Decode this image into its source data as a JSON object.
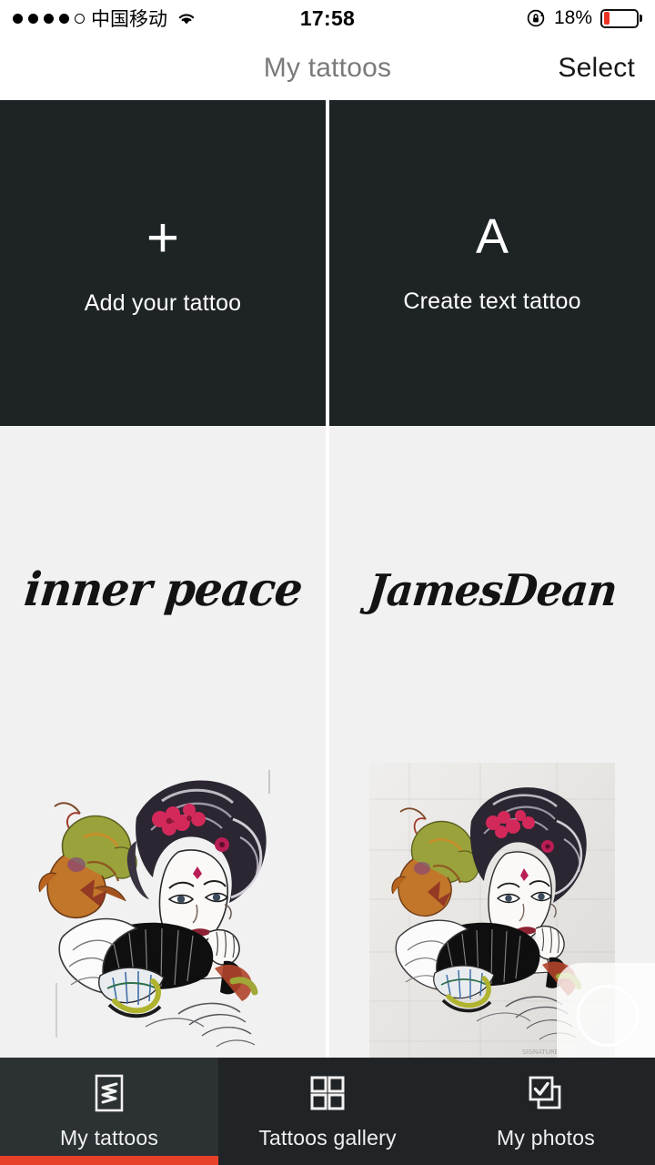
{
  "status_bar": {
    "signal_dots_filled": 4,
    "signal_dots_total": 5,
    "carrier": "中国移动",
    "wifi_icon": "wifi-icon",
    "time": "17:58",
    "rotation_lock_icon": "rotation-lock-icon",
    "battery_percent": "18%",
    "battery_level": 18,
    "battery_color": "#ec3323"
  },
  "header": {
    "title": "My tattoos",
    "action_label": "Select",
    "title_color": "#7a7a7a",
    "action_color": "#16181a"
  },
  "grid": {
    "rows": [
      {
        "type": "actions",
        "cells": [
          {
            "kind": "action",
            "glyph": "+",
            "glyph_name": "plus-icon",
            "label": "Add your tattoo",
            "bg": "#1e2326"
          },
          {
            "kind": "action",
            "glyph": "A",
            "glyph_name": "letter-a-icon",
            "label": "Create text tattoo",
            "bg": "#1e2326"
          }
        ]
      },
      {
        "type": "text_tattoos",
        "cells": [
          {
            "kind": "text",
            "text": "inner peace",
            "bg": "#f1f1f1",
            "ink": "#131313"
          },
          {
            "kind": "text",
            "text": "JamesDean",
            "bg": "#f1f1f1",
            "ink": "#131313"
          }
        ]
      },
      {
        "type": "image_tattoos",
        "cells": [
          {
            "kind": "image",
            "alt": "geisha-with-fan-tattoo",
            "framed": false,
            "watermark": false,
            "bg": "#f1f1f1"
          },
          {
            "kind": "image",
            "alt": "geisha-with-fan-tattoo-photo",
            "framed": true,
            "watermark": true,
            "bg": "#f1f1f1"
          }
        ]
      }
    ]
  },
  "tabbar": {
    "active_index": 0,
    "active_bg": "#2c3134",
    "inactive_bg": "#212426",
    "indicator_color": "#e8412a",
    "tabs": [
      {
        "label": "My tattoos",
        "icon": "tattoo-sketch-icon"
      },
      {
        "label": "Tattoos gallery",
        "icon": "grid-four-squares-icon"
      },
      {
        "label": "My photos",
        "icon": "checked-photos-icon"
      }
    ]
  }
}
